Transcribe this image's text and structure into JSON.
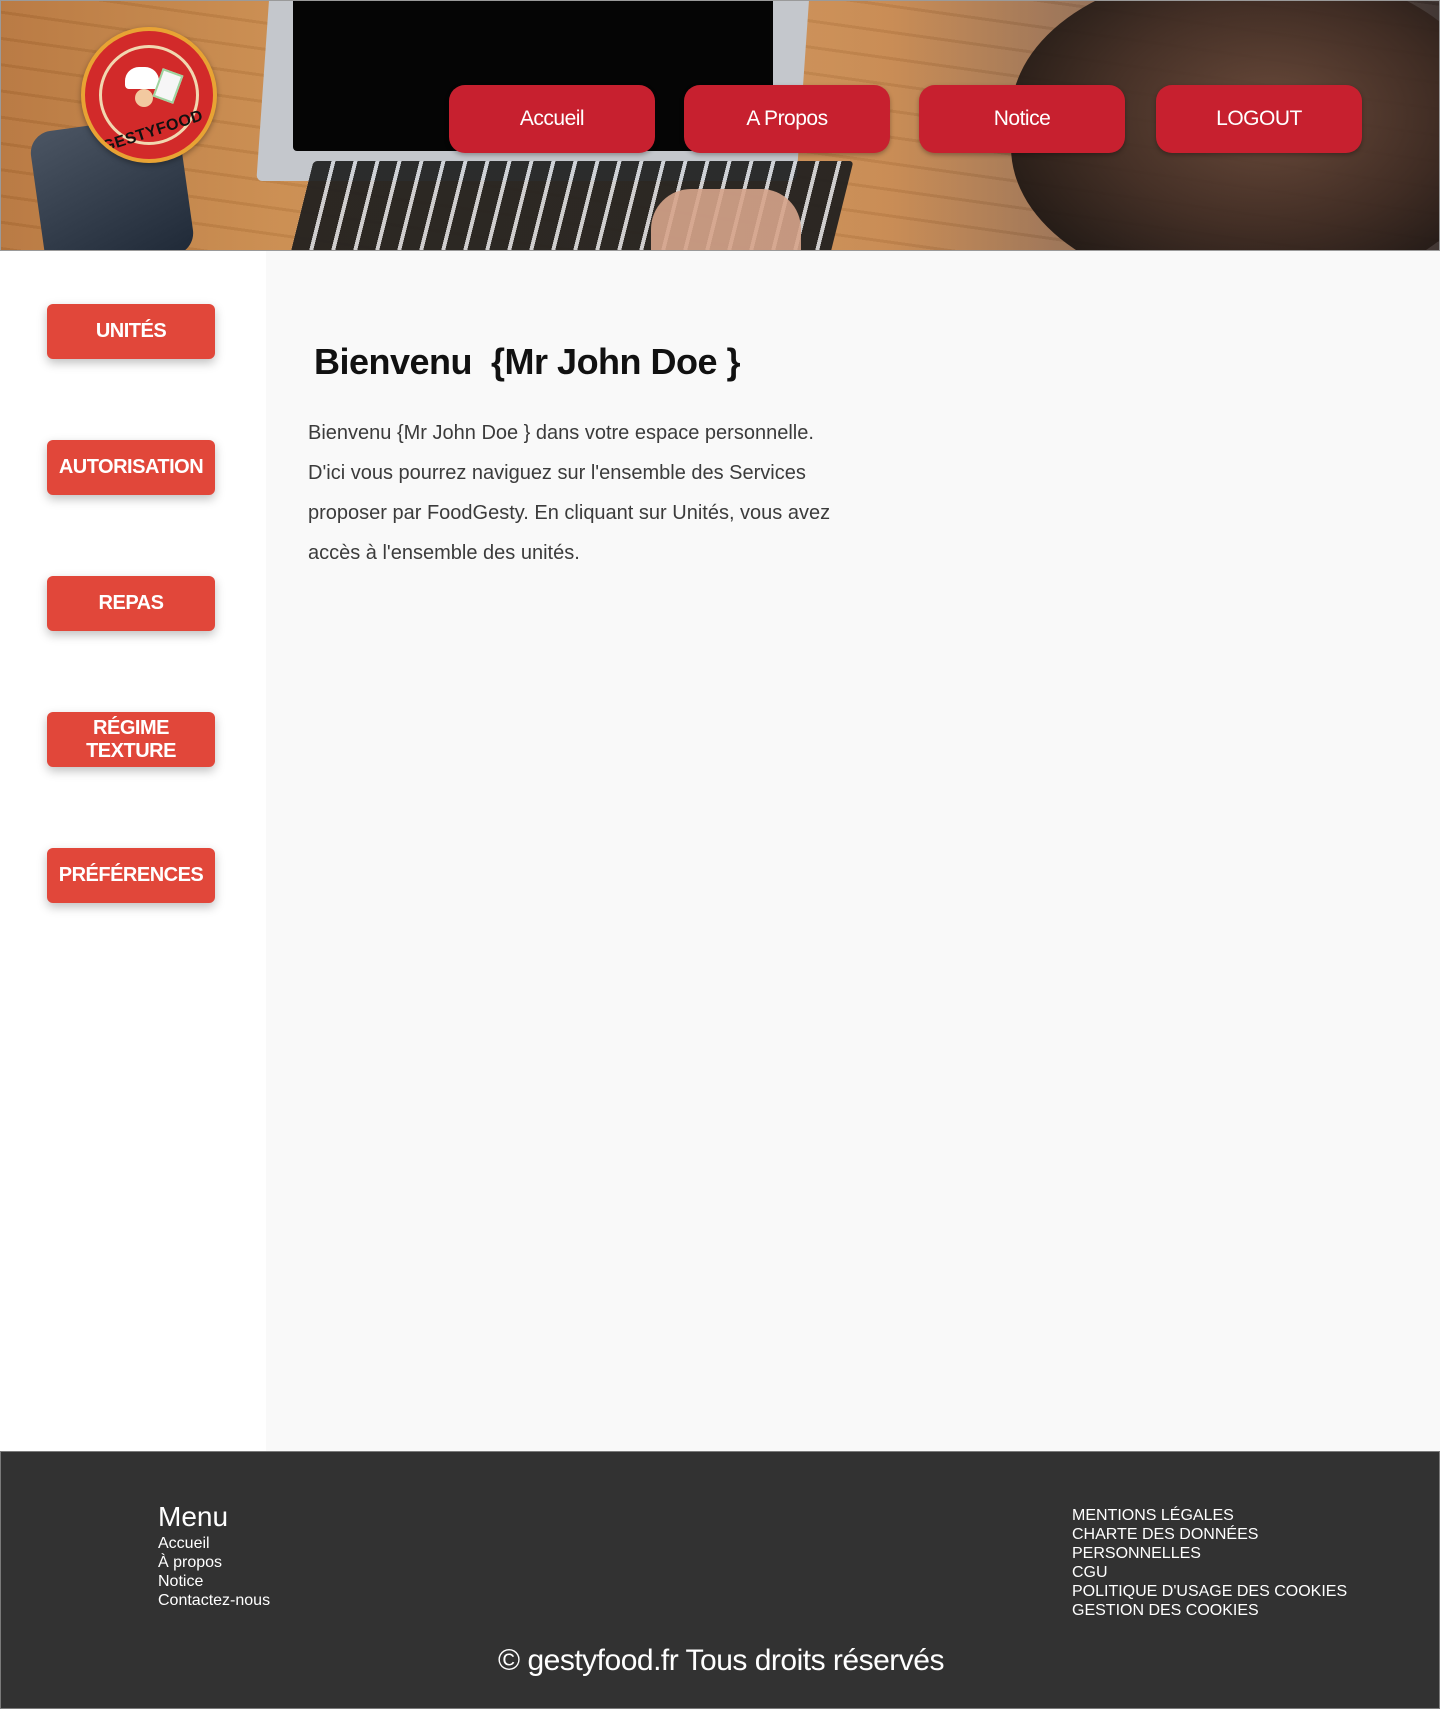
{
  "header": {
    "logo_text": "GESTYFOOD",
    "nav": [
      "Accueil",
      "A Propos",
      "Notice",
      "LOGOUT"
    ]
  },
  "sidebar": {
    "items": [
      "UNITÉS",
      "AUTORISATION",
      "REPAS",
      "RÉGIME TEXTURE",
      "PRÉFÉRENCES"
    ]
  },
  "main": {
    "title": "Bienvenu  {Mr John Doe }",
    "intro": "Bienvenu  {Mr John Doe } dans votre espace personnelle.\nD'ici vous pourrez naviguez sur l'ensemble des Services\nproposer par FoodGesty.   En cliquant sur Unités, vous avez\naccès à l'ensemble des unités."
  },
  "footer": {
    "menu_title": "Menu",
    "menu_links": [
      "Accueil",
      "À propos",
      "Notice",
      "Contactez-nous"
    ],
    "legal_links": [
      "MENTIONS LÉGALES",
      "CHARTE DES DONNÉES",
      "PERSONNELLES",
      "CGU",
      "POLITIQUE D'USAGE DES COOKIES",
      "GESTION DES COOKIES"
    ],
    "copyright": "© gestyfood.fr  Tous droits réservés"
  },
  "colors": {
    "nav_button": "#c7202f",
    "sidebar_button": "#e1473a",
    "footer_bg": "#323232",
    "main_bg": "#f9f9f9"
  }
}
